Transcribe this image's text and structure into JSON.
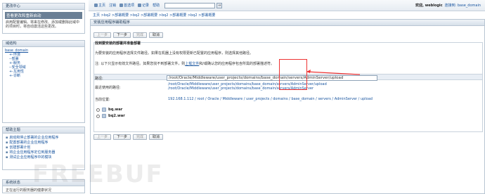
{
  "left": {
    "change_center": {
      "title": "更改中心",
      "bar": "查看更改和重新启动",
      "text": "启用配置编辑。将来在修改、添加或删除此域中的项目时，将自动激活这些更改。"
    },
    "domain_structure": {
      "title": "域结构",
      "root": "base_domain",
      "nodes": [
        "环境",
        "部署",
        "服务",
        "安全领域",
        "互用性",
        "诊断"
      ]
    },
    "help": {
      "title": "帮助主题",
      "items": [
        "启动和停止部署的企业应用程序",
        "配置部署的企业应用程序",
        "创建部署计划",
        "将企业应用程序定位到服务器",
        "测试企业应用程序中的模块"
      ]
    },
    "status": {
      "title": "系统状态",
      "text": "正在运行的服务器的健康状况"
    }
  },
  "top": {
    "nav": [
      "主页",
      "注销",
      "首选项",
      "记录",
      "帮助"
    ],
    "search_button": "→",
    "welcome_text": "欢迎, weblogic",
    "connected": "连接到: base_domain"
  },
  "breadcrumb": "主页 >bq2 >部署概要 >bq2 >部署概要 >bq2 >部署概要 >bq2 >部署概要",
  "main": {
    "title": "安装应用程序辅助程序",
    "buttons": [
      "上一步",
      "下一步",
      "完成",
      "取消"
    ],
    "heading": "找到要安装的部署并准备部署",
    "desc": "为要安装的应用程序选择文件路径。如果在机器上没有权限更新已配置的应用程序，则选择其他路径。",
    "note_prefix": "注: 以下只显示有效文件路径。如果您找不到部署文件，则",
    "note_link": "上载文件",
    "note_suffix": "和/或确认您的应用程序包含所需的部署描述符。",
    "path_label": "路径:",
    "path_value": "/root/Oracle/Middleware/user_projects/domains/base_domain/servers/AdminServer/upload",
    "recent_label": "最近使用的路径:",
    "recent_paths": [
      "/root/Oracle/Middleware/user_projects/domains/base_domain/servers/AdminServer/upload",
      "/root/Oracle/Middleware/user_projects/domains/base_domain/servers/AdminServer"
    ],
    "current_label": "当前位置:",
    "current_path": "192.168.1.112 / root / Oracle / Middleware / user_projects / domains / base_domain / servers / AdminServer / upload",
    "files": [
      "bq.war",
      "bq2.war"
    ]
  },
  "watermark": "FREEBUF"
}
